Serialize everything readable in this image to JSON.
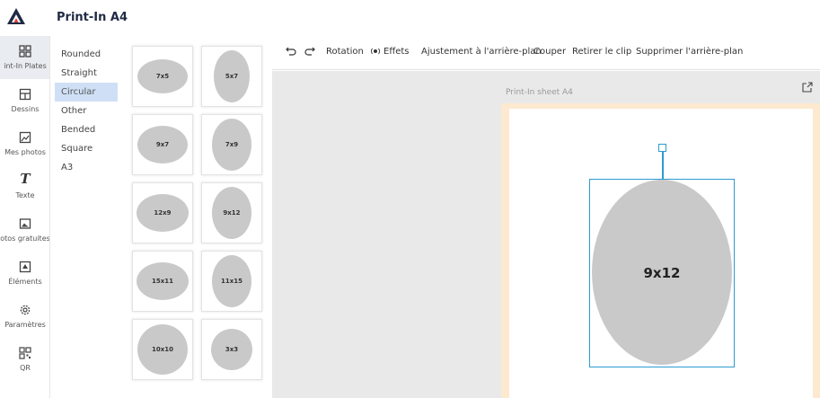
{
  "app": {
    "title": "Print-In A4",
    "brand_color": "#1f2a44",
    "accent_color": "#e53935"
  },
  "rail": {
    "items": [
      {
        "label": "int-In Plates",
        "icon": "grid-icon"
      },
      {
        "label": "Dessins",
        "icon": "layout-icon"
      },
      {
        "label": "Mes photos",
        "icon": "photos-icon"
      },
      {
        "label": "Texte",
        "icon": "text-icon"
      },
      {
        "label": "otos gratuites",
        "icon": "image-icon"
      },
      {
        "label": "Éléments",
        "icon": "elements-icon"
      },
      {
        "label": "Paramètres",
        "icon": "settings-icon"
      },
      {
        "label": "QR",
        "icon": "qr-icon"
      }
    ]
  },
  "categories": {
    "items": [
      "Rounded",
      "Straight",
      "Circular",
      "Other",
      "Bended",
      "Square",
      "A3"
    ],
    "selected": "Circular"
  },
  "templates": [
    {
      "label": "7x5"
    },
    {
      "label": "5x7"
    },
    {
      "label": "9x7"
    },
    {
      "label": "7x9"
    },
    {
      "label": "12x9"
    },
    {
      "label": "9x12"
    },
    {
      "label": "15x11"
    },
    {
      "label": "11x15"
    },
    {
      "label": "10x10"
    },
    {
      "label": "3x3"
    }
  ],
  "toolbar": {
    "undo_icon": "undo-icon",
    "redo_icon": "redo-icon",
    "rotation": "Rotation",
    "effects": "Effets",
    "adjust_bg": "Ajustement à l'arrière-plan",
    "cut": "Couper",
    "remove_clip": "Retirer le clip",
    "remove_bg": "Supprimer l'arrière-plan"
  },
  "canvas": {
    "sheet_label": "Print-In sheet A4",
    "selected_shape_label": "9x12",
    "selection_color": "#2e9bd0",
    "sheet_border_color": "#fde9cf"
  }
}
